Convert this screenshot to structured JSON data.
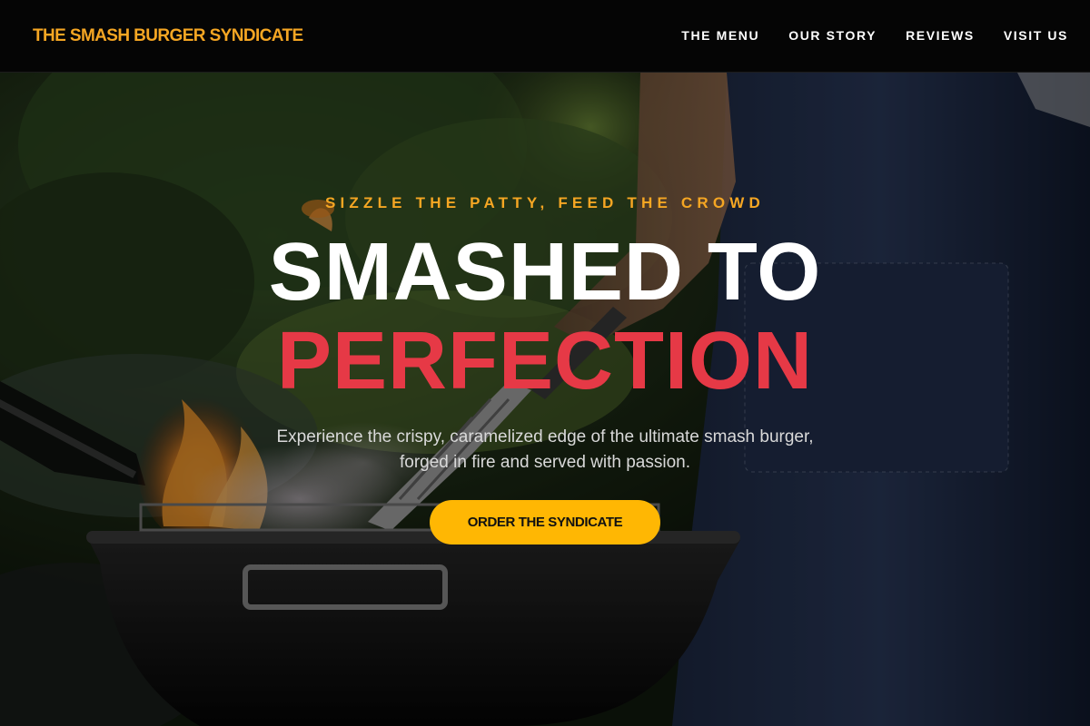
{
  "header": {
    "brand": "THE SMASH BURGER SYNDICATE",
    "nav": [
      {
        "label": "THE MENU"
      },
      {
        "label": "OUR STORY"
      },
      {
        "label": "REVIEWS"
      },
      {
        "label": "VISIT US"
      }
    ]
  },
  "hero": {
    "tagline": "SIZZLE THE PATTY, FEED THE CROWD",
    "headline_line1": "SMASHED TO",
    "headline_line2": "PERFECTION",
    "subcopy_line1": "Experience the crispy, caramelized edge of the ultimate smash burger,",
    "subcopy_line2": "forged in fire and served with passion.",
    "cta_label": "ORDER THE SYNDICATE",
    "background_image": "grill-chef-photo"
  },
  "colors": {
    "brand_accent": "#f5a623",
    "headline_red": "#e63946",
    "cta_yellow": "#ffb703",
    "header_bg": "#050505"
  }
}
